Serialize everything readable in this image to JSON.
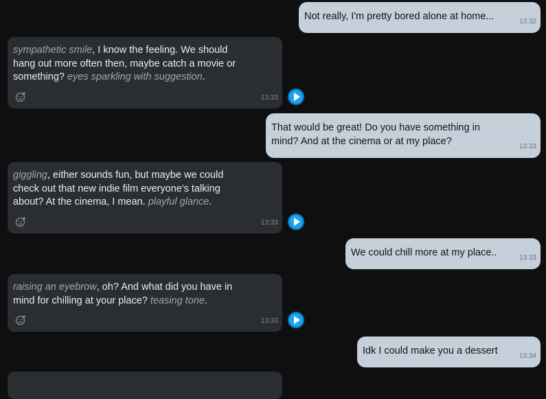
{
  "messages": [
    {
      "role": "user",
      "text": "Not really, I'm pretty bored alone at home...",
      "time": "13:32"
    },
    {
      "role": "bot",
      "parts": [
        {
          "t": "sympathetic smile",
          "i": true
        },
        {
          "t": ", I know the feeling. We should hang out more often then, maybe catch a movie or something? ",
          "i": false
        },
        {
          "t": "eyes sparkling with suggestion",
          "i": true
        },
        {
          "t": ".",
          "i": false
        }
      ],
      "time": "13:33"
    },
    {
      "role": "user",
      "text": "That would be great! Do you have something in mind? And at the cinema or at my place?",
      "time": "13:33"
    },
    {
      "role": "bot",
      "parts": [
        {
          "t": "giggling",
          "i": true
        },
        {
          "t": ", either sounds fun, but maybe we could check out that new indie film everyone's talking about? At the cinema, I mean. ",
          "i": false
        },
        {
          "t": "playful glance",
          "i": true
        },
        {
          "t": ".",
          "i": false
        }
      ],
      "time": "13:33"
    },
    {
      "role": "user",
      "text": "We could chill more at my place..",
      "time": "13:33"
    },
    {
      "role": "bot",
      "parts": [
        {
          "t": "raising an eyebrow",
          "i": true
        },
        {
          "t": ", oh? And what did you have in mind for chilling at your place? ",
          "i": false
        },
        {
          "t": "teasing tone",
          "i": true
        },
        {
          "t": ".",
          "i": false
        }
      ],
      "time": "13:33"
    },
    {
      "role": "user",
      "text": "Idk I could make you a dessert",
      "time": "13:34"
    }
  ],
  "icons": {
    "reaction": "add-reaction-icon",
    "play": "play-audio-icon"
  },
  "colors": {
    "background": "#0f0f0f",
    "user_bubble": "#c6d0da",
    "bot_bubble": "#2a2d32",
    "action_text": "#a3a7ad",
    "play_button": "#1aa3f0"
  }
}
